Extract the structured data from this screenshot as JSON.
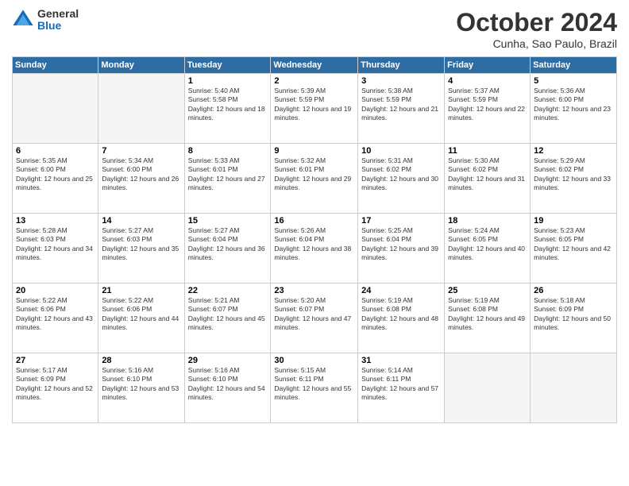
{
  "header": {
    "logo": {
      "general": "General",
      "blue": "Blue"
    },
    "title": "October 2024",
    "location": "Cunha, Sao Paulo, Brazil"
  },
  "days_of_week": [
    "Sunday",
    "Monday",
    "Tuesday",
    "Wednesday",
    "Thursday",
    "Friday",
    "Saturday"
  ],
  "weeks": [
    [
      {
        "day": "",
        "empty": true
      },
      {
        "day": "",
        "empty": true
      },
      {
        "day": "1",
        "sunrise": "5:40 AM",
        "sunset": "5:58 PM",
        "daylight": "12 hours and 18 minutes."
      },
      {
        "day": "2",
        "sunrise": "5:39 AM",
        "sunset": "5:59 PM",
        "daylight": "12 hours and 19 minutes."
      },
      {
        "day": "3",
        "sunrise": "5:38 AM",
        "sunset": "5:59 PM",
        "daylight": "12 hours and 21 minutes."
      },
      {
        "day": "4",
        "sunrise": "5:37 AM",
        "sunset": "5:59 PM",
        "daylight": "12 hours and 22 minutes."
      },
      {
        "day": "5",
        "sunrise": "5:36 AM",
        "sunset": "6:00 PM",
        "daylight": "12 hours and 23 minutes."
      }
    ],
    [
      {
        "day": "6",
        "sunrise": "5:35 AM",
        "sunset": "6:00 PM",
        "daylight": "12 hours and 25 minutes."
      },
      {
        "day": "7",
        "sunrise": "5:34 AM",
        "sunset": "6:00 PM",
        "daylight": "12 hours and 26 minutes."
      },
      {
        "day": "8",
        "sunrise": "5:33 AM",
        "sunset": "6:01 PM",
        "daylight": "12 hours and 27 minutes."
      },
      {
        "day": "9",
        "sunrise": "5:32 AM",
        "sunset": "6:01 PM",
        "daylight": "12 hours and 29 minutes."
      },
      {
        "day": "10",
        "sunrise": "5:31 AM",
        "sunset": "6:02 PM",
        "daylight": "12 hours and 30 minutes."
      },
      {
        "day": "11",
        "sunrise": "5:30 AM",
        "sunset": "6:02 PM",
        "daylight": "12 hours and 31 minutes."
      },
      {
        "day": "12",
        "sunrise": "5:29 AM",
        "sunset": "6:02 PM",
        "daylight": "12 hours and 33 minutes."
      }
    ],
    [
      {
        "day": "13",
        "sunrise": "5:28 AM",
        "sunset": "6:03 PM",
        "daylight": "12 hours and 34 minutes."
      },
      {
        "day": "14",
        "sunrise": "5:27 AM",
        "sunset": "6:03 PM",
        "daylight": "12 hours and 35 minutes."
      },
      {
        "day": "15",
        "sunrise": "5:27 AM",
        "sunset": "6:04 PM",
        "daylight": "12 hours and 36 minutes."
      },
      {
        "day": "16",
        "sunrise": "5:26 AM",
        "sunset": "6:04 PM",
        "daylight": "12 hours and 38 minutes."
      },
      {
        "day": "17",
        "sunrise": "5:25 AM",
        "sunset": "6:04 PM",
        "daylight": "12 hours and 39 minutes."
      },
      {
        "day": "18",
        "sunrise": "5:24 AM",
        "sunset": "6:05 PM",
        "daylight": "12 hours and 40 minutes."
      },
      {
        "day": "19",
        "sunrise": "5:23 AM",
        "sunset": "6:05 PM",
        "daylight": "12 hours and 42 minutes."
      }
    ],
    [
      {
        "day": "20",
        "sunrise": "5:22 AM",
        "sunset": "6:06 PM",
        "daylight": "12 hours and 43 minutes."
      },
      {
        "day": "21",
        "sunrise": "5:22 AM",
        "sunset": "6:06 PM",
        "daylight": "12 hours and 44 minutes."
      },
      {
        "day": "22",
        "sunrise": "5:21 AM",
        "sunset": "6:07 PM",
        "daylight": "12 hours and 45 minutes."
      },
      {
        "day": "23",
        "sunrise": "5:20 AM",
        "sunset": "6:07 PM",
        "daylight": "12 hours and 47 minutes."
      },
      {
        "day": "24",
        "sunrise": "5:19 AM",
        "sunset": "6:08 PM",
        "daylight": "12 hours and 48 minutes."
      },
      {
        "day": "25",
        "sunrise": "5:19 AM",
        "sunset": "6:08 PM",
        "daylight": "12 hours and 49 minutes."
      },
      {
        "day": "26",
        "sunrise": "5:18 AM",
        "sunset": "6:09 PM",
        "daylight": "12 hours and 50 minutes."
      }
    ],
    [
      {
        "day": "27",
        "sunrise": "5:17 AM",
        "sunset": "6:09 PM",
        "daylight": "12 hours and 52 minutes."
      },
      {
        "day": "28",
        "sunrise": "5:16 AM",
        "sunset": "6:10 PM",
        "daylight": "12 hours and 53 minutes."
      },
      {
        "day": "29",
        "sunrise": "5:16 AM",
        "sunset": "6:10 PM",
        "daylight": "12 hours and 54 minutes."
      },
      {
        "day": "30",
        "sunrise": "5:15 AM",
        "sunset": "6:11 PM",
        "daylight": "12 hours and 55 minutes."
      },
      {
        "day": "31",
        "sunrise": "5:14 AM",
        "sunset": "6:11 PM",
        "daylight": "12 hours and 57 minutes."
      },
      {
        "day": "",
        "empty": true
      },
      {
        "day": "",
        "empty": true
      }
    ]
  ],
  "labels": {
    "sunrise": "Sunrise:",
    "sunset": "Sunset:",
    "daylight": "Daylight:"
  }
}
